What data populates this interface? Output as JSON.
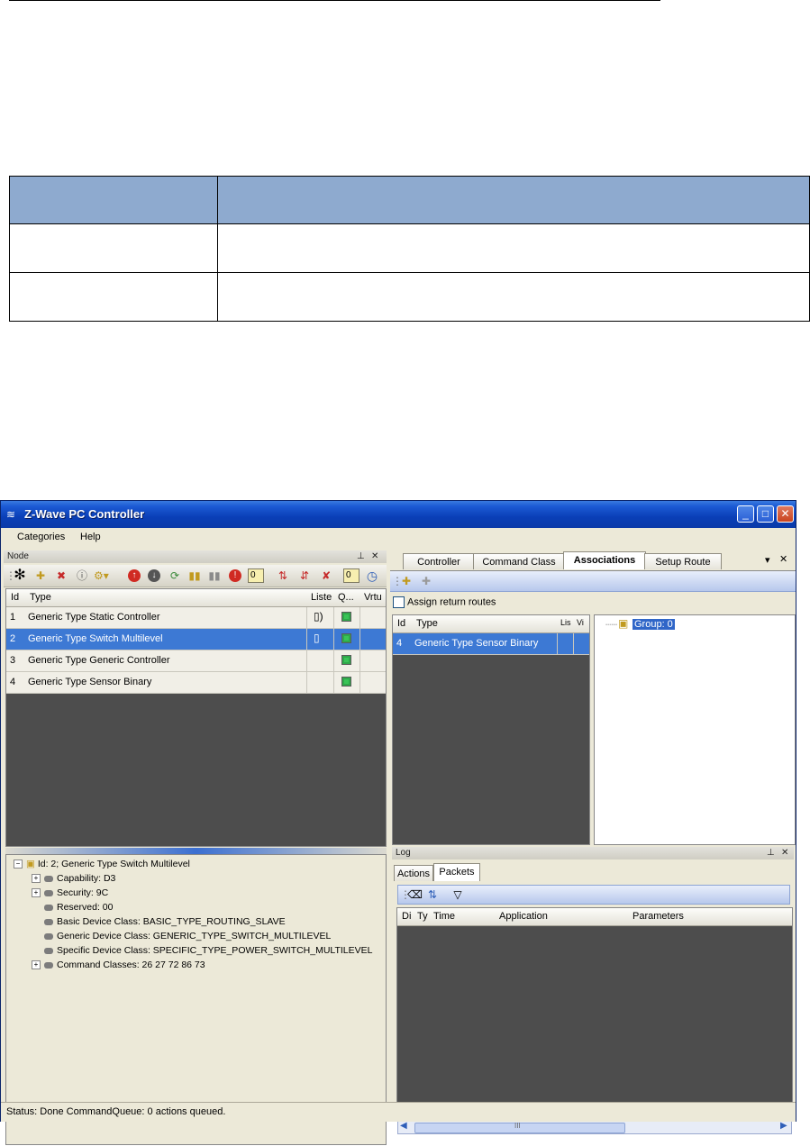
{
  "window": {
    "title": "Z-Wave PC Controller",
    "menu": [
      "Categories",
      "Help"
    ]
  },
  "node_panel": {
    "title": "Node",
    "counter1": "0",
    "counter2": "0",
    "columns": [
      "Id",
      "Type",
      "Liste",
      "Q...",
      "Vrtu"
    ],
    "rows": [
      {
        "id": "1",
        "type": "Generic Type Static Controller"
      },
      {
        "id": "2",
        "type": "Generic Type Switch Multilevel"
      },
      {
        "id": "3",
        "type": "Generic Type Generic Controller"
      },
      {
        "id": "4",
        "type": "Generic Type Sensor Binary"
      }
    ]
  },
  "tree": {
    "root": "Id: 2; Generic Type Switch Multilevel",
    "items": [
      "Capability: D3",
      "Security: 9C",
      "Reserved: 00",
      "Basic Device Class: BASIC_TYPE_ROUTING_SLAVE",
      "Generic Device Class: GENERIC_TYPE_SWITCH_MULTILEVEL",
      "Specific Device Class: SPECIFIC_TYPE_POWER_SWITCH_MULTILEVEL",
      "Command Classes: 26 27 72 86 73"
    ]
  },
  "tabs": [
    "Controller",
    "Command Class",
    "Associations",
    "Setup Route"
  ],
  "associations": {
    "assign_label": "Assign return routes",
    "columns": [
      "Id",
      "Type",
      "Lis",
      "Vi"
    ],
    "row": {
      "id": "4",
      "type": "Generic Type Sensor Binary"
    },
    "group_label": "Group: 0"
  },
  "log": {
    "title": "Log",
    "tabs": [
      "Actions",
      "Packets"
    ],
    "columns": [
      "Di",
      "Ty",
      "Time",
      "Application",
      "Parameters"
    ],
    "scroll_glyph": "III"
  },
  "status": "Status: Done  CommandQueue: 0 actions queued."
}
